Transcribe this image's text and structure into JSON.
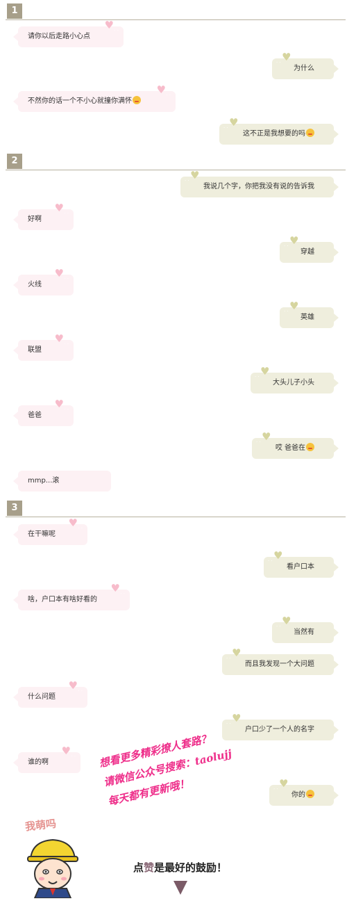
{
  "sections": [
    {
      "number": "1",
      "messages": [
        {
          "side": "l",
          "text": "请你以后走路小心点",
          "emoji": ""
        },
        {
          "side": "r",
          "text": "为什么",
          "emoji": ""
        },
        {
          "side": "l",
          "text": "不然你的话一个不小心就撞你满怀",
          "emoji": "wink-kiss-emoji"
        },
        {
          "side": "r",
          "text": "这不正是我想要的吗",
          "emoji": "laughing-tears-emoji"
        }
      ]
    },
    {
      "number": "2",
      "messages": [
        {
          "side": "r",
          "text": "我说几个字，你把我没有说的告诉我",
          "emoji": ""
        },
        {
          "side": "l",
          "text": "好啊",
          "emoji": ""
        },
        {
          "side": "r",
          "text": "穿越",
          "emoji": ""
        },
        {
          "side": "l",
          "text": "火线",
          "emoji": ""
        },
        {
          "side": "r",
          "text": "英雄",
          "emoji": ""
        },
        {
          "side": "l",
          "text": "联盟",
          "emoji": ""
        },
        {
          "side": "r",
          "text": "大头儿子小头",
          "emoji": ""
        },
        {
          "side": "l",
          "text": "爸爸",
          "emoji": ""
        },
        {
          "side": "r",
          "text": "哎 爸爸在",
          "emoji": "smile-emoji"
        },
        {
          "side": "l",
          "text": "mmp...滚",
          "emoji": ""
        }
      ]
    },
    {
      "number": "3",
      "messages": [
        {
          "side": "l",
          "text": "在干嘛呢",
          "emoji": ""
        },
        {
          "side": "r",
          "text": "看户口本",
          "emoji": ""
        },
        {
          "side": "l",
          "text": "啥，户口本有啥好看的",
          "emoji": ""
        },
        {
          "side": "r",
          "text": "当然有",
          "emoji": ""
        },
        {
          "side": "r",
          "text": "而且我发现一个大问题",
          "emoji": ""
        },
        {
          "side": "l",
          "text": "什么问题",
          "emoji": ""
        },
        {
          "side": "r",
          "text": "户口少了一个人的名字",
          "emoji": ""
        },
        {
          "side": "l",
          "text": "谁的啊",
          "emoji": ""
        },
        {
          "side": "r",
          "text": "你的",
          "emoji": "smile-emoji"
        }
      ]
    }
  ],
  "decor": {
    "heart": "♥",
    "dots": "· ·"
  },
  "promo": {
    "line1": "想看更多精彩撩人套路？",
    "line2": "请微信公众号搜索：taolujj",
    "line3": "每天都有更新哦！"
  },
  "footer": {
    "cute_text": "我萌吗",
    "like_prefix": "点",
    "like_highlight": "赞",
    "like_suffix": "是最好的鼓励！"
  },
  "colors": {
    "left_bubble": "#fdf1f4",
    "right_bubble": "#efeedd",
    "section_badge": "#a79f8a",
    "promo_text": "#ee2e8a"
  }
}
